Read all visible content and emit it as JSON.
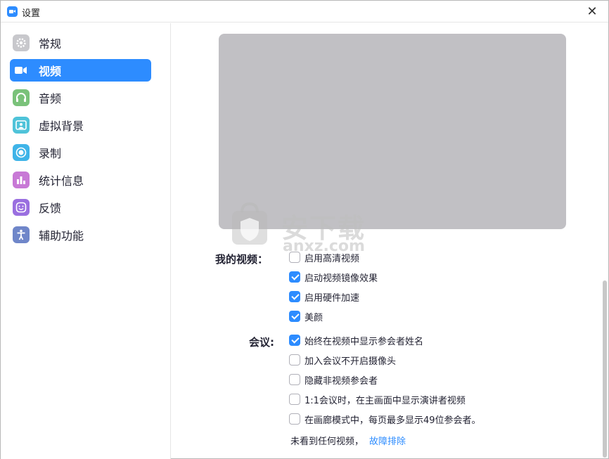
{
  "window": {
    "title": "设置",
    "close_glyph": "✕"
  },
  "sidebar": {
    "items": [
      {
        "label": "常规",
        "icon": "gear-icon",
        "color": "#c8c8cc",
        "active": false
      },
      {
        "label": "视频",
        "icon": "video-camera-icon",
        "color": "#2d8cff",
        "active": true
      },
      {
        "label": "音频",
        "icon": "headphones-icon",
        "color": "#7ac27a",
        "active": false
      },
      {
        "label": "虚拟背景",
        "icon": "person-frame-icon",
        "color": "#4fc3d9",
        "active": false
      },
      {
        "label": "录制",
        "icon": "record-icon",
        "color": "#3fb4e8",
        "active": false
      },
      {
        "label": "统计信息",
        "icon": "bar-chart-icon",
        "color": "#c879d6",
        "active": false
      },
      {
        "label": "反馈",
        "icon": "smiley-icon",
        "color": "#9a6fe0",
        "active": false
      },
      {
        "label": "辅助功能",
        "icon": "accessibility-icon",
        "color": "#6f86c9",
        "active": false
      }
    ]
  },
  "main": {
    "my_video_label": "我的视频：",
    "my_video_options": [
      {
        "label": "启用高清视频",
        "checked": false
      },
      {
        "label": "启动视频镜像效果",
        "checked": true
      },
      {
        "label": "启用硬件加速",
        "checked": true
      },
      {
        "label": "美颜",
        "checked": true
      }
    ],
    "meeting_label": "会议:",
    "meeting_options": [
      {
        "label": "始终在视频中显示参会者姓名",
        "checked": true
      },
      {
        "label": "加入会议不开启摄像头",
        "checked": false
      },
      {
        "label": "隐藏非视频参会者",
        "checked": false
      },
      {
        "label": "1:1会议时，在主画面中显示演讲者视频",
        "checked": false
      },
      {
        "label": "在画廊模式中，每页最多显示49位参会者。",
        "checked": false
      }
    ],
    "help_text": "未看到任何视频，",
    "help_link": "故障排除"
  },
  "watermark": {
    "text": "安下载",
    "sub": "anxz.com"
  }
}
